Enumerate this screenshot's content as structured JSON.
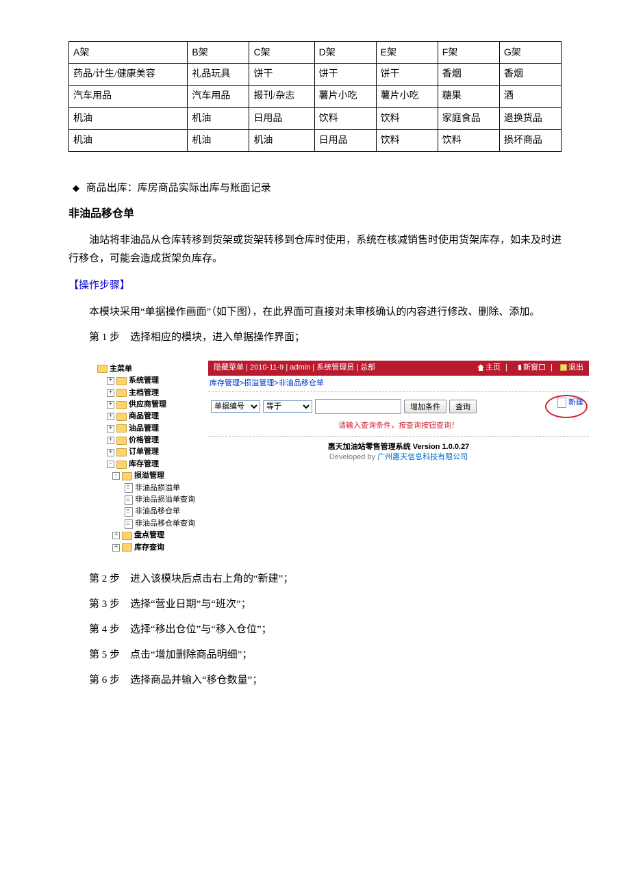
{
  "shelfTable": {
    "headers": [
      "A架",
      "B架",
      "C架",
      "D架",
      "E架",
      "F架",
      "G架"
    ],
    "rows": [
      [
        "药品/计生/健康美容",
        "礼品玩具",
        "饼干",
        "饼干",
        "饼干",
        "香烟",
        "香烟"
      ],
      [
        "汽车用品",
        "汽车用品",
        "报刊/杂志",
        "薯片小吃",
        "薯片小吃",
        "糖果",
        "酒"
      ],
      [
        "机油",
        "机油",
        "日用品",
        "饮料",
        "饮料",
        "家庭食品",
        "退换货品"
      ],
      [
        "机油",
        "机油",
        "机油",
        "日用品",
        "饮料",
        "饮料",
        "损坏商品"
      ]
    ]
  },
  "bullet1": "商品出库：库房商品实际出库与账面记录",
  "sectionTitle": "非油品移仓单",
  "para1": "油站将非油品从仓库转移到货架或货架转移到仓库时使用，系统在核减销售时使用货架库存，如未及时进行移仓，可能会造成货架负库存。",
  "opsHeading": "【操作步骤】",
  "para2": "本模块采用“单据操作画面”（如下图），在此界面可直接对未审核确认的内容进行修改、删除、添加。",
  "steps": [
    "第 1 步　选择相应的模块，进入单据操作界面；",
    "第 2 步　进入该模块后点击右上角的“新建”；",
    "第 3 步　选择“营业日期”与“班次”；",
    "第 4 步　选择“移出仓位”与“移入仓位”；",
    "第 5 步　点击“增加删除商品明细”；",
    "第 6 步　选择商品并输入“移仓数量”；"
  ],
  "app": {
    "tree": {
      "root": "主菜单",
      "items": [
        "系统管理",
        "主档管理",
        "供应商管理",
        "商品管理",
        "油品管理",
        "价格管理",
        "订单管理"
      ],
      "inventory": {
        "label": "库存管理",
        "sub": {
          "label": "损溢管理",
          "children": [
            "非油品损溢单",
            "非油品损溢单查询",
            "非油品移仓单",
            "非油品移仓单查询"
          ]
        },
        "others": [
          "盘点管理",
          "库存查询"
        ]
      }
    },
    "topbar": {
      "left": "隐藏菜单 | 2010-11-9 | admin | 系统管理员 | 总部",
      "home": "主页",
      "newWindow": "新窗口",
      "logout": "退出"
    },
    "breadcrumb": "库存管理>损溢管理>非油品移仓单",
    "query": {
      "field": "单据编号",
      "op": "等于",
      "addCondBtn": "增加条件",
      "searchBtn": "查询",
      "newLabel": "新建"
    },
    "hint": "请输入查询条件，按查询按钮查询！",
    "footer": {
      "sysName": "惠天加油站零售管理系统",
      "version": "Version 1.0.0.27",
      "devBy": "Developed by",
      "company": "广州惠天信息科技有限公司"
    }
  }
}
